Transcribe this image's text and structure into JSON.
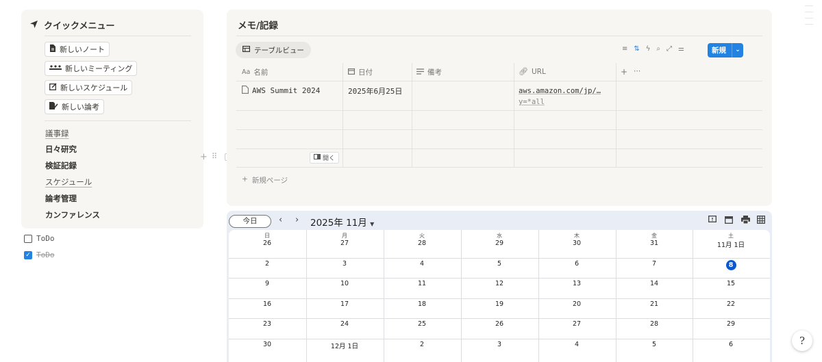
{
  "quick_menu": {
    "title": "クイックメニュー",
    "buttons": [
      "新しいノート",
      "新しいミーティング",
      "新しいスケジュール",
      "新しい論考"
    ],
    "links": [
      "議事録",
      "日々研究",
      "検証記録",
      "スケジュール",
      "論考管理",
      "カンファレンス"
    ]
  },
  "todos": [
    {
      "label": "ToDo",
      "checked": false
    },
    {
      "label": "ToDo",
      "checked": true
    }
  ],
  "memo": {
    "title": "メモ/記録",
    "view_tab": "テーブルビュー",
    "new_button": "新規",
    "columns": [
      "名前",
      "日付",
      "備考",
      "URL"
    ],
    "col_icons": [
      "Aa",
      "calendar-icon",
      "text-icon",
      "link-icon"
    ],
    "rows": [
      {
        "name": "AWS Summit 2024",
        "date": "2025年6月25日",
        "note": "",
        "url_line1": "aws.amazon.com/jp/…",
        "url_line2": "y=*all"
      }
    ],
    "open_label": "開く",
    "new_page": "新規ページ"
  },
  "calendar": {
    "today_button": "今日",
    "month_label": "2025年 11月",
    "weekdays": [
      "日",
      "月",
      "火",
      "水",
      "木",
      "金",
      "土"
    ],
    "first_row": [
      "26",
      "27",
      "28",
      "29",
      "30",
      "31",
      "11月 1日"
    ],
    "weeks": [
      [
        "2",
        "3",
        "4",
        "5",
        "6",
        "7",
        "8"
      ],
      [
        "9",
        "10",
        "11",
        "12",
        "13",
        "14",
        "15"
      ],
      [
        "16",
        "17",
        "18",
        "19",
        "20",
        "21",
        "22"
      ],
      [
        "23",
        "24",
        "25",
        "26",
        "27",
        "28",
        "29"
      ],
      [
        "30",
        "12月 1日",
        "2",
        "3",
        "4",
        "5",
        "6"
      ]
    ],
    "today": "8"
  },
  "colors": {
    "accent": "#2383e2",
    "today": "#0b57d0"
  }
}
